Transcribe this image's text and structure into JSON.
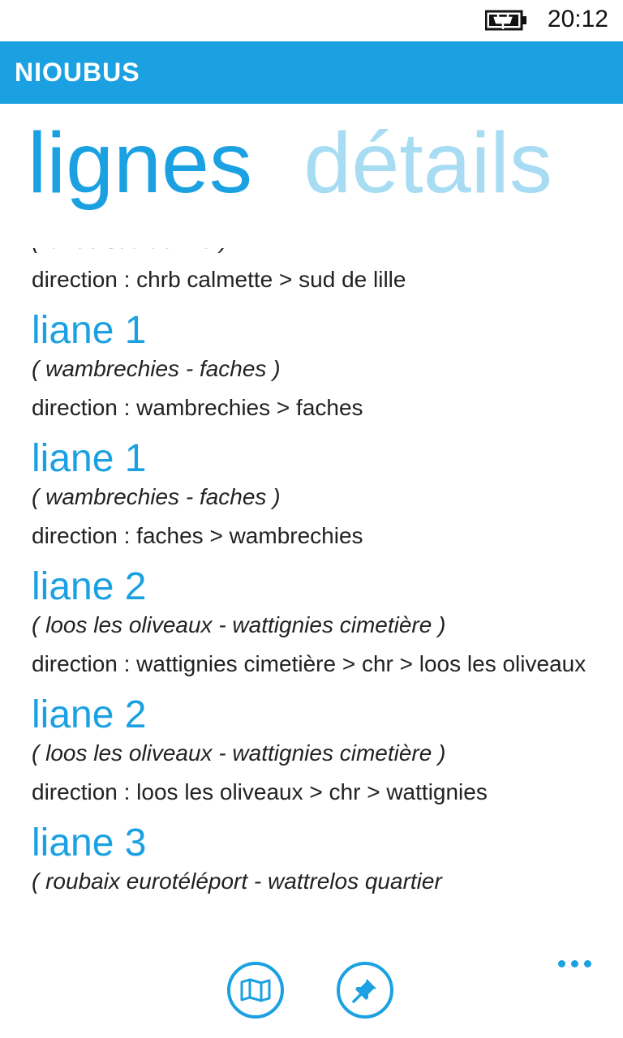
{
  "status_bar": {
    "time": "20:12",
    "battery_icon": "battery-charging-icon"
  },
  "app_bar": {
    "title": "NIOUBUS"
  },
  "pivot": {
    "active": "lignes",
    "inactive": "détails"
  },
  "lines": [
    {
      "title": "",
      "subtitle": "( itinéo sud de lille )",
      "direction": "direction : chrb calmette > sud de lille"
    },
    {
      "title": "liane 1",
      "subtitle": "( wambrechies - faches )",
      "direction": "direction : wambrechies > faches"
    },
    {
      "title": "liane 1",
      "subtitle": "( wambrechies - faches )",
      "direction": "direction : faches > wambrechies"
    },
    {
      "title": "liane 2",
      "subtitle": "( loos les oliveaux - wattignies cimetière )",
      "direction": "direction : wattignies cimetière > chr > loos les oliveaux"
    },
    {
      "title": "liane 2",
      "subtitle": "( loos les oliveaux - wattignies cimetière )",
      "direction": "direction : loos les oliveaux > chr > wattignies"
    },
    {
      "title": "liane 3",
      "subtitle": "( roubaix eurotéléport - wattrelos quartier",
      "direction": ""
    }
  ],
  "app_bar_buttons": {
    "map_icon": "map-icon",
    "pin_icon": "pin-icon",
    "more_icon": "more-icon",
    "accent_color": "#1ba1e2"
  }
}
